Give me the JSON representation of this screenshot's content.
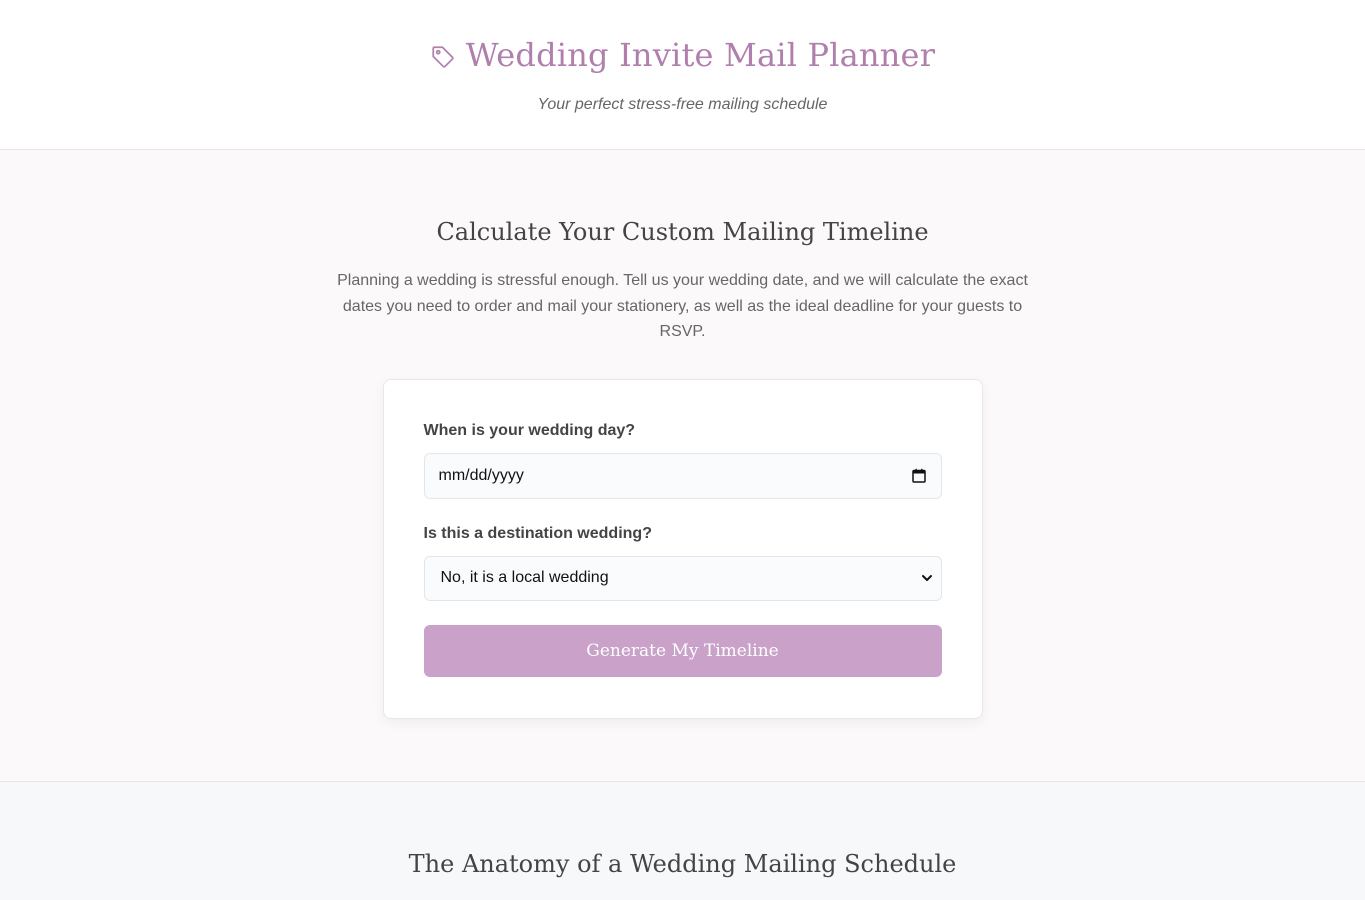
{
  "header": {
    "title": "Wedding Invite Mail Planner",
    "tagline": "Your perfect stress-free mailing schedule",
    "icon": "tag-icon"
  },
  "calculator": {
    "heading": "Calculate Your Custom Mailing Timeline",
    "intro": "Planning a wedding is stressful enough. Tell us your wedding date, and we will calculate the exact dates you need to order and mail your stationery, as well as the ideal deadline for your guests to RSVP.",
    "date_label": "When is your wedding day?",
    "date_value": "mm/dd/yyyy",
    "destination_label": "Is this a destination wedding?",
    "destination_selected": "No, it is a local wedding",
    "button_label": "Generate My Timeline"
  },
  "anatomy": {
    "heading": "The Anatomy of a Wedding Mailing Schedule"
  },
  "colors": {
    "accent": "#b07fae",
    "button": "#c9a1c9",
    "page_bg": "#fcf9fb"
  }
}
